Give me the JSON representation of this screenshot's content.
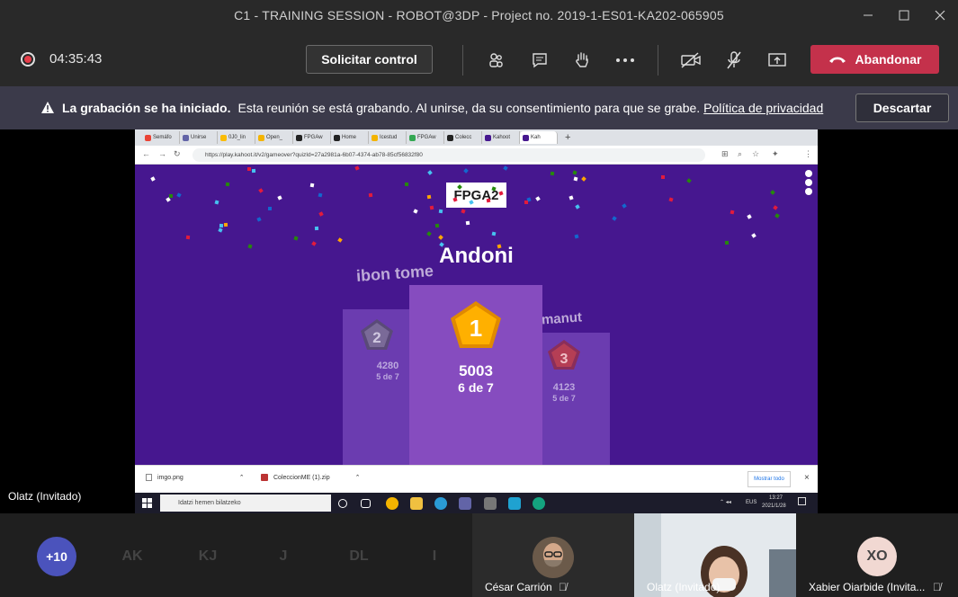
{
  "window": {
    "title": "C1 - TRAINING SESSION - ROBOT@3DP - Project no. 2019-1-ES01-KA202-065905"
  },
  "toolbar": {
    "timer": "04:35:43",
    "request_control_label": "Solicitar control",
    "leave_label": "Abandonar",
    "icons": [
      "participants-icon",
      "chat-icon",
      "raise-hand-icon",
      "more-icon",
      "camera-off-icon",
      "mic-off-icon",
      "share-icon"
    ],
    "colors": {
      "leave": "#c4314b",
      "recording": "#e63e4a"
    }
  },
  "banner": {
    "title": "La grabación se ha iniciado.",
    "message": "Esta reunión se está grabando. Al unirse, da su consentimiento para que se grabe.",
    "link": "Política de privacidad",
    "dismiss_label": "Descartar"
  },
  "stage": {
    "presenter_name": "Olatz (Invitado)"
  },
  "shared_screen": {
    "browser_tabs": [
      "Semáfo",
      "Unirse",
      "0J0_lin",
      "Open_",
      "FPGAw",
      "Home",
      "Icestud",
      "FPGAw",
      "Colecc",
      "Kahoot",
      "Kah"
    ],
    "url": "https://play.kahoot.it/v2/gameover?quizId=27a2981a-6b07-4374-ab78-85cf56832f80",
    "kahoot": {
      "logo_text": "FPGA2",
      "winner_name": "Andoni",
      "podium": [
        {
          "rank": "1",
          "name": "Andoni",
          "score": "5003",
          "correct": "6 de 7"
        },
        {
          "rank": "2",
          "name": "ibon tome",
          "score": "4280",
          "correct": "5 de 7"
        },
        {
          "rank": "3",
          "name": "manut",
          "score": "4123",
          "correct": "5 de 7"
        }
      ]
    },
    "downloads": [
      {
        "file": "imgo.png"
      },
      {
        "file": "ColeccionME (1).zip"
      }
    ],
    "show_all_label": "Mostrar todo",
    "taskbar": {
      "search_placeholder": "Idatzi hemen bilatzeko",
      "lang": "EUS",
      "time": "13:27",
      "date": "2021/1/28"
    }
  },
  "roster": {
    "overflow_count": "+10",
    "avatars": [
      {
        "initials": "AK",
        "color": "#d8e3d3"
      },
      {
        "initials": "KJ",
        "color": "#f6e1c9"
      },
      {
        "initials": "J",
        "color": "#e9cfe3"
      },
      {
        "initials": "DL",
        "color": "#f3d4d8"
      },
      {
        "initials": "I",
        "color": "#dcdcf0"
      }
    ],
    "video_tiles": [
      {
        "name": "César Carrión"
      },
      {
        "name": "Olatz (Invitado)"
      }
    ],
    "last_tile": {
      "initials": "XO",
      "name": "Xabier Oiarbide (Invita..."
    }
  }
}
